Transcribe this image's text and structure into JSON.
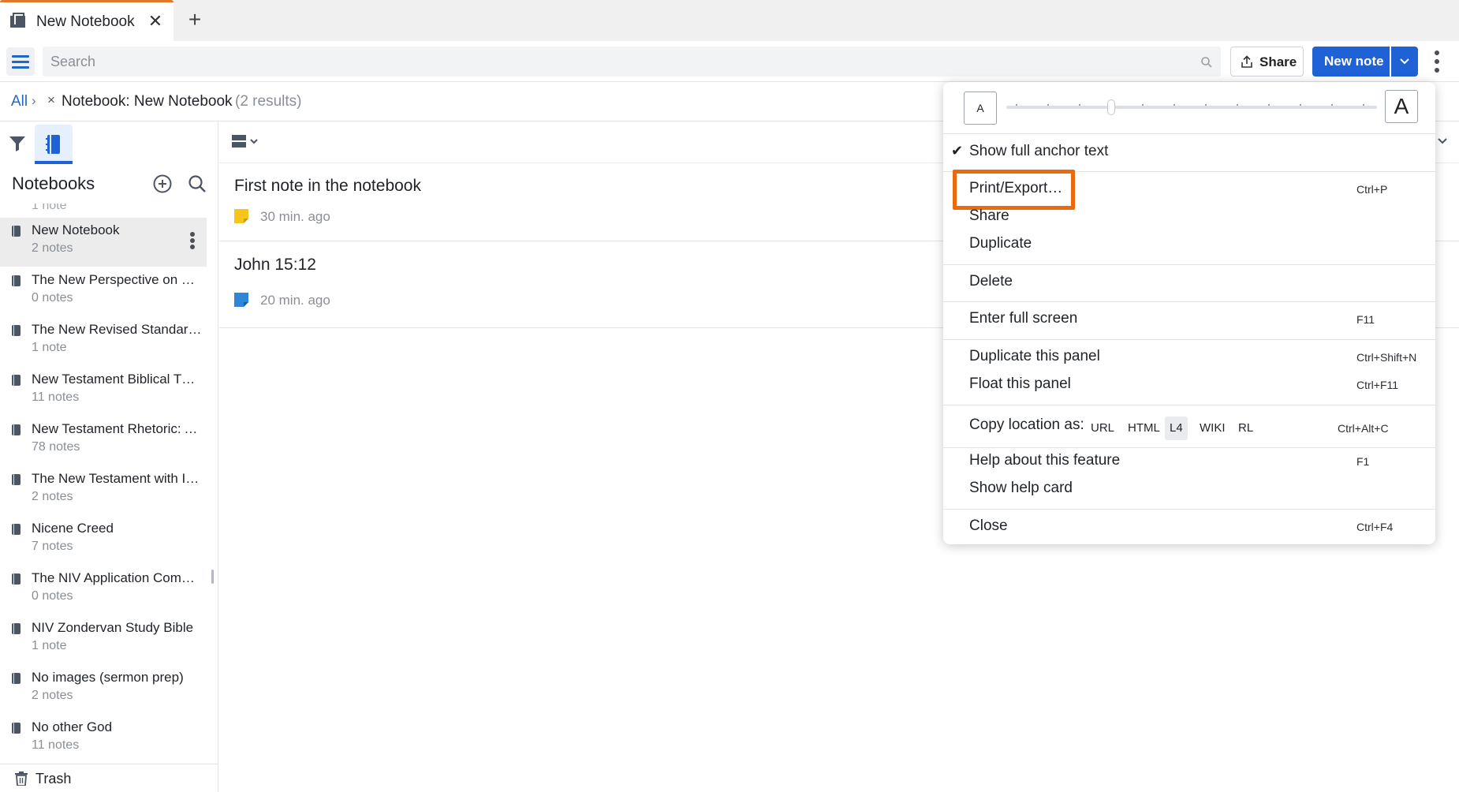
{
  "tab": {
    "title": "New Notebook",
    "close": "✕",
    "add": "+"
  },
  "toolbar": {
    "search_placeholder": "Search",
    "share_label": "Share",
    "new_note_label": "New note"
  },
  "breadcrumb": {
    "all": "All",
    "sep": "›",
    "remove": "×",
    "label": "Notebook: New Notebook",
    "count": "(2 results)"
  },
  "sidebar": {
    "heading": "Notebooks",
    "partial_count": "1 note",
    "items": [
      {
        "title": "New Notebook",
        "count": "2 notes"
      },
      {
        "title": "The New Perspective on Paul",
        "count": "0 notes"
      },
      {
        "title": "The New Revised Standard Version",
        "count": "1 note"
      },
      {
        "title": "New Testament Biblical Theology",
        "count": "11 notes"
      },
      {
        "title": "New Testament Rhetoric: An Introduction",
        "count": "78 notes"
      },
      {
        "title": "The New Testament with Introductions",
        "count": "2 notes"
      },
      {
        "title": "Nicene Creed",
        "count": "7 notes"
      },
      {
        "title": "The NIV Application Commentary",
        "count": "0 notes"
      },
      {
        "title": "NIV Zondervan Study Bible",
        "count": "1 note"
      },
      {
        "title": "No images (sermon prep)",
        "count": "2 notes"
      },
      {
        "title": "No other God",
        "count": "11 notes"
      }
    ],
    "trash": "Trash"
  },
  "notes": [
    {
      "title": "First note in the notebook",
      "time": "30 min. ago",
      "color": "#f5c518"
    },
    {
      "title": "John 15:12",
      "time": "20 min. ago",
      "color": "#2d86d6"
    }
  ],
  "menu": {
    "font_small": "A",
    "font_large": "A",
    "check": "✔",
    "show_anchor": "Show full anchor text",
    "print": "Print/Export…",
    "print_sc": "Ctrl+P",
    "share": "Share",
    "duplicate": "Duplicate",
    "delete": "Delete",
    "fullscreen": "Enter full screen",
    "fullscreen_sc": "F11",
    "dup_panel": "Duplicate this panel",
    "dup_panel_sc": "Ctrl+Shift+N",
    "float_panel": "Float this panel",
    "float_panel_sc": "Ctrl+F11",
    "copy_loc": "Copy location as:",
    "formats": [
      "URL",
      "HTML",
      "L4",
      "WIKI",
      "RL"
    ],
    "active_format": "L4",
    "copy_loc_sc": "Ctrl+Alt+C",
    "help": "Help about this feature",
    "help_sc": "F1",
    "help_card": "Show help card",
    "close": "Close",
    "close_sc": "Ctrl+F4"
  },
  "colors": {
    "accent": "#1f62d8",
    "highlight": "#ec6a0e",
    "tab_accent": "#e3782a"
  }
}
